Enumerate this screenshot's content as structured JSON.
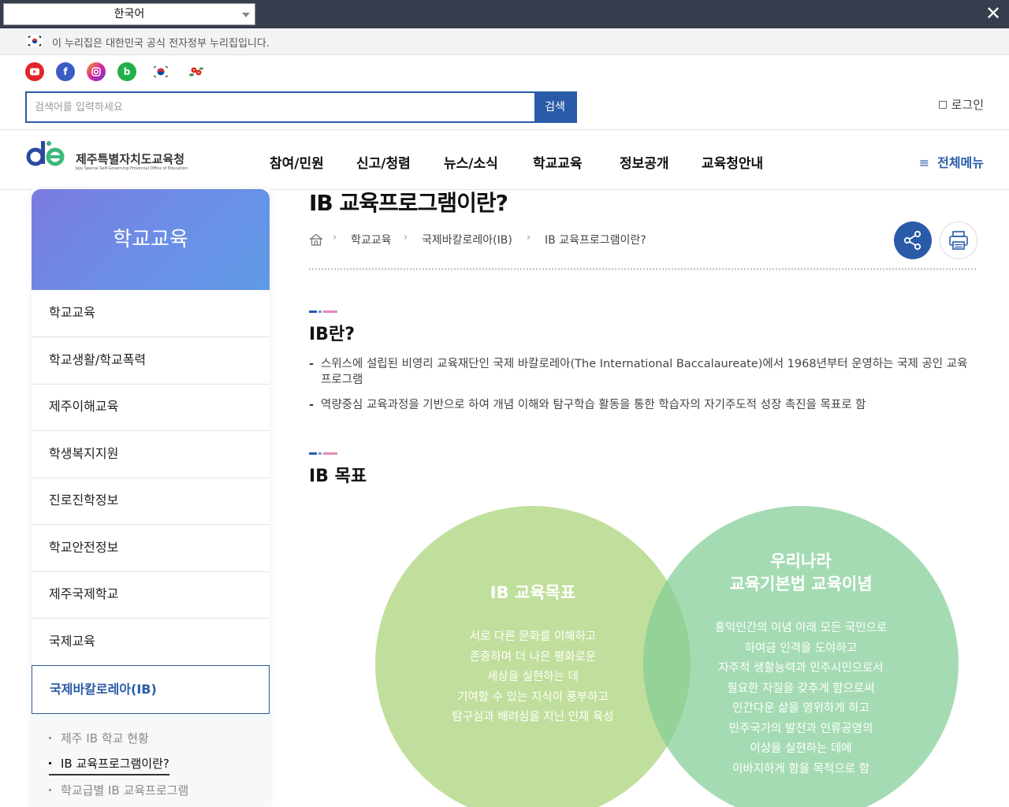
{
  "translate_bar": {
    "language_selected": "한국어",
    "close_label": "✕"
  },
  "gov_banner": {
    "text": "이 누리집은 대한민국 공식 전자정부 누리집입니다."
  },
  "sns": [
    "youtube-icon",
    "facebook-icon",
    "instagram-icon",
    "blog-icon",
    "taegeuk-icon",
    "camellia-icon"
  ],
  "search": {
    "placeholder": "검색어를 입력하세요",
    "button_label": "검색"
  },
  "login_label": "로그인",
  "logo": {
    "title": "제주특별자치도교육청",
    "subtitle": "Jeju Special Self-Governing Provincial Office of Education"
  },
  "gnb": [
    "참여/민원",
    "신고/청렴",
    "뉴스/소식",
    "학교교육",
    "정보공개",
    "교육청안내"
  ],
  "allmenu_label": "전체메뉴",
  "lnb": {
    "title": "학교교육",
    "items": [
      "학교교육",
      "학교생활/학교폭력",
      "제주이해교육",
      "학생복지지원",
      "진로진학정보",
      "학교안전정보",
      "제주국제학교",
      "국제교육",
      "국제바칼로레아(IB)"
    ],
    "active_index": 8,
    "sub_items": [
      "제주 IB 학교 현황",
      "IB 교육프로그램이란?",
      "학교급별 IB 교육프로그램"
    ],
    "sub_current_index": 1
  },
  "page": {
    "title": "IB 교육프로그램이란?",
    "breadcrumb": [
      "학교교육",
      "국제바칼로레아(IB)",
      "IB 교육프로그램이란?"
    ]
  },
  "sections": [
    {
      "title": "IB란?",
      "bullets": [
        "스위스에 설립된 비영리 교육재단인 국제 바칼로레아(The International Baccalaureate)에서 1968년부터 운영하는 국제 공인 교육프로그램",
        "역량중심 교육과정을 기반으로 하여 개념 이해와 탐구학습 활동을 통한 학습자의 자기주도적 성장 촉진을 목표로 함"
      ]
    },
    {
      "title": "IB 목표"
    }
  ],
  "venn": {
    "left": {
      "title": "IB 교육목표",
      "lines": [
        "서로 다른 문화를 이해하고",
        "존중하며 더 나은 평화로운",
        "세상을 실현하는 데",
        "기여할 수 있는 지식이 풍부하고",
        "탐구심과 배려심을 지닌 인재 육성"
      ]
    },
    "right": {
      "title_lines": [
        "우리나라",
        "교육기본법 교육이념"
      ],
      "lines": [
        "홍익인간의 이념 아래 모든 국민으로",
        "하여금 인격을 도야하고",
        "자주적 생활능력과 민주시민으로서",
        "필요한 자질을 갖추게 함으로써",
        "인간다운 삶을 영위하게 하고",
        "민주국가의 발전과 인류공영의",
        "이상을 실현하는 데에",
        "이바지하게 함을 목적으로 함"
      ]
    }
  },
  "colors": {
    "primary": "#2a5ba8",
    "venn_left": "#b0d680",
    "venn_right": "#82cd96"
  }
}
